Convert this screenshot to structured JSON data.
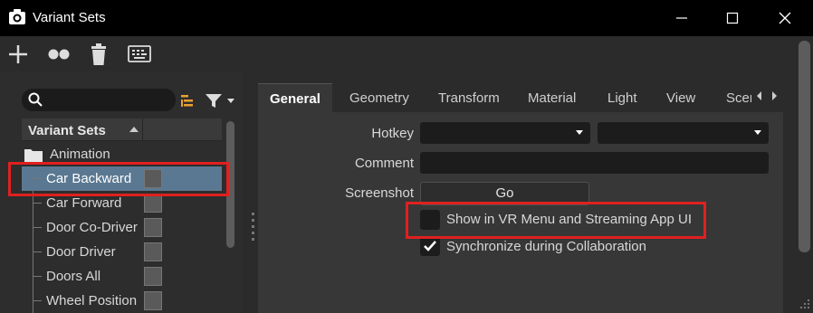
{
  "window": {
    "title": "Variant Sets",
    "icon": "camera-icon",
    "controls": [
      "minimize-icon",
      "maximize-icon",
      "close-icon"
    ]
  },
  "toolbar": {
    "buttons": [
      "add-icon",
      "variant-group-icon",
      "delete-icon",
      "keyboard-icon"
    ]
  },
  "search": {
    "placeholder": "",
    "value": ""
  },
  "tree": {
    "header": "Variant Sets",
    "group": "Animation",
    "items": [
      {
        "label": "Car Backward",
        "selected": true
      },
      {
        "label": "Car Forward",
        "selected": false
      },
      {
        "label": "Door Co-Driver",
        "selected": false
      },
      {
        "label": "Door Driver",
        "selected": false
      },
      {
        "label": "Doors All",
        "selected": false
      },
      {
        "label": "Wheel Position",
        "selected": false
      }
    ]
  },
  "tabs": [
    "General",
    "Geometry",
    "Transform",
    "Material",
    "Light",
    "View",
    "Scen"
  ],
  "active_tab": "General",
  "form": {
    "hotkey_label": "Hotkey",
    "hotkey_value1": "",
    "hotkey_value2": "",
    "comment_label": "Comment",
    "comment_value": "",
    "screenshot_label": "Screenshot",
    "go_label": "Go",
    "vr_menu_label": "Show in VR Menu and Streaming App UI",
    "vr_menu_checked": false,
    "sync_label": "Synchronize during Collaboration",
    "sync_checked": true
  },
  "colors": {
    "selection": "#5a7891",
    "highlight_box": "#e02020",
    "accent_orange": "#e8a030"
  }
}
